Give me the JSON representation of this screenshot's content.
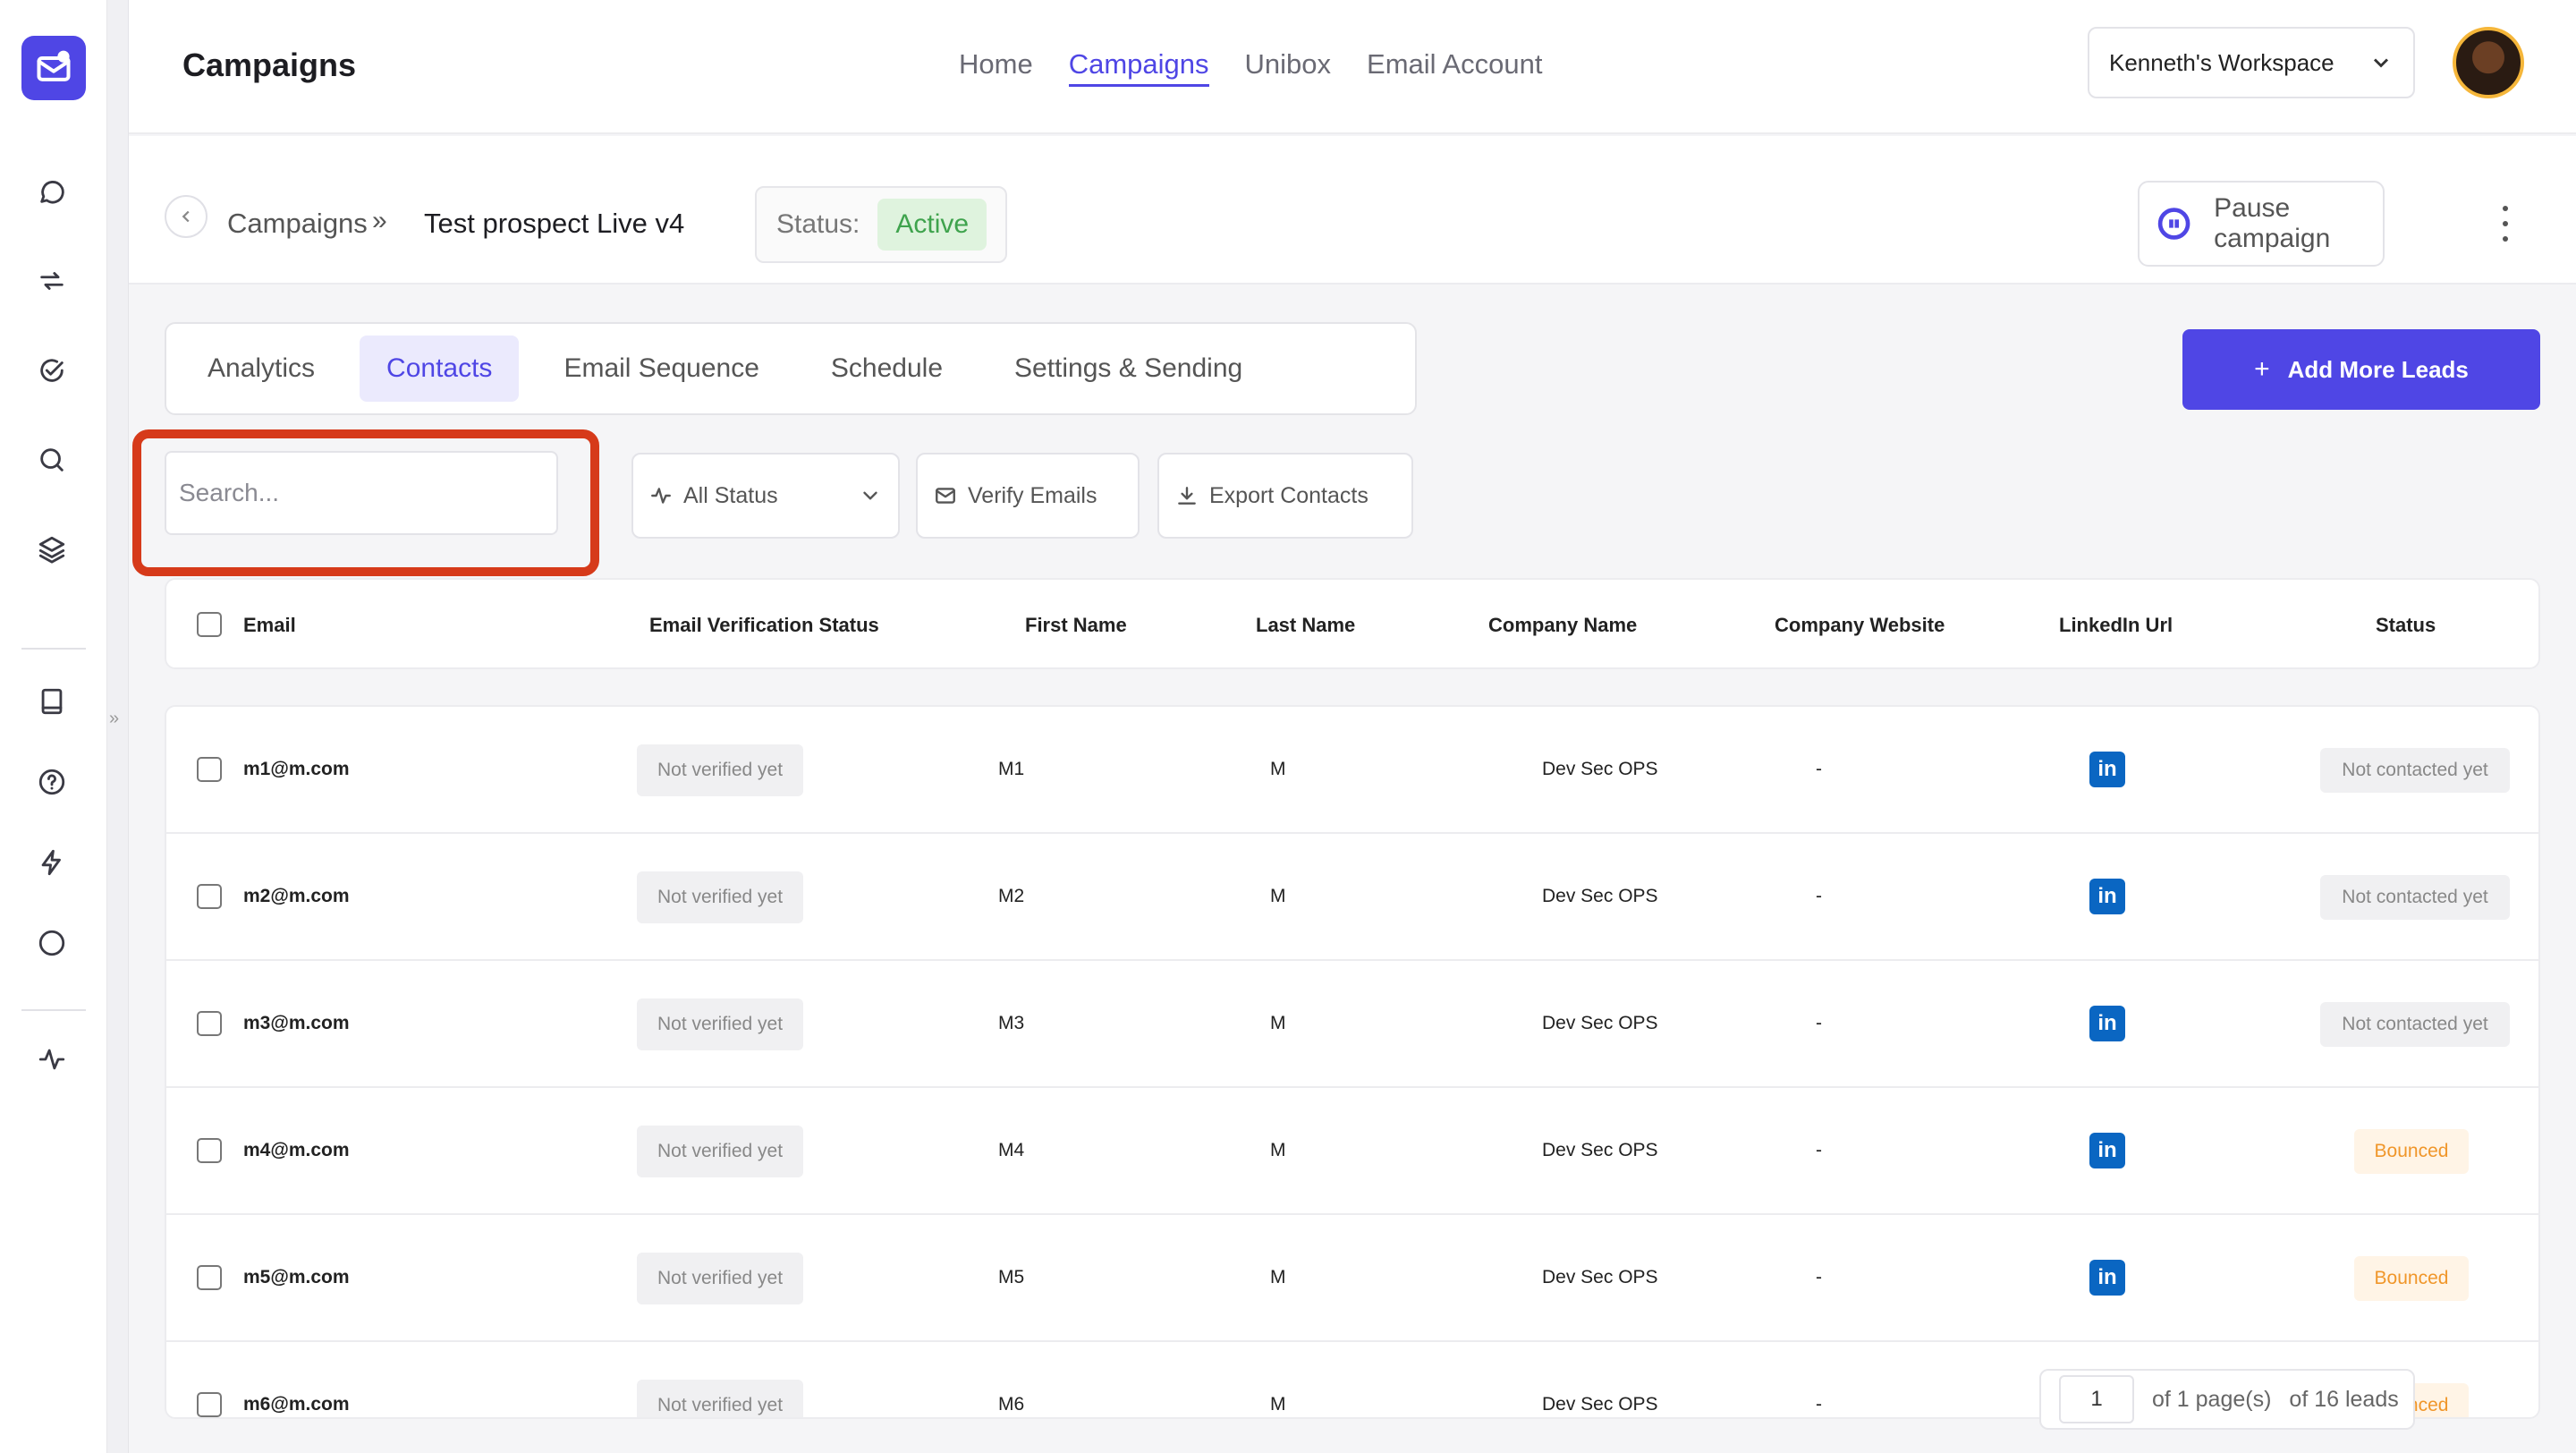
{
  "header": {
    "title": "Campaigns",
    "nav": [
      {
        "label": "Home",
        "active": false
      },
      {
        "label": "Campaigns",
        "active": true
      },
      {
        "label": "Unibox",
        "active": false
      },
      {
        "label": "Email Account",
        "active": false
      }
    ],
    "workspace": "Kenneth's Workspace"
  },
  "breadcrumb": {
    "parent": "Campaigns",
    "separator": "»",
    "current": "Test prospect Live v4"
  },
  "status": {
    "label": "Status:",
    "value": "Active"
  },
  "actions": {
    "pause": "Pause campaign",
    "add_leads": "Add More Leads",
    "add_leads_icon": "+"
  },
  "tabs": [
    {
      "label": "Analytics",
      "active": false
    },
    {
      "label": "Contacts",
      "active": true
    },
    {
      "label": "Email Sequence",
      "active": false
    },
    {
      "label": "Schedule",
      "active": false
    },
    {
      "label": "Settings & Sending",
      "active": false
    }
  ],
  "toolbar": {
    "search_placeholder": "Search...",
    "status_filter": "All Status",
    "verify": "Verify Emails",
    "export": "Export Contacts"
  },
  "table": {
    "columns": [
      "Email",
      "Email Verification Status",
      "First Name",
      "Last Name",
      "Company Name",
      "Company Website",
      "LinkedIn Url",
      "Status"
    ],
    "rows": [
      {
        "email": "m1@m.com",
        "verification": "Not verified yet",
        "first": "M1",
        "last": "M",
        "company": "Dev Sec OPS",
        "website": "-",
        "status": "Not contacted yet"
      },
      {
        "email": "m2@m.com",
        "verification": "Not verified yet",
        "first": "M2",
        "last": "M",
        "company": "Dev Sec OPS",
        "website": "-",
        "status": "Not contacted yet"
      },
      {
        "email": "m3@m.com",
        "verification": "Not verified yet",
        "first": "M3",
        "last": "M",
        "company": "Dev Sec OPS",
        "website": "-",
        "status": "Not contacted yet"
      },
      {
        "email": "m4@m.com",
        "verification": "Not verified yet",
        "first": "M4",
        "last": "M",
        "company": "Dev Sec OPS",
        "website": "-",
        "status": "Bounced"
      },
      {
        "email": "m5@m.com",
        "verification": "Not verified yet",
        "first": "M5",
        "last": "M",
        "company": "Dev Sec OPS",
        "website": "-",
        "status": "Bounced"
      },
      {
        "email": "m6@m.com",
        "verification": "Not verified yet",
        "first": "M6",
        "last": "M",
        "company": "Dev Sec OPS",
        "website": "-",
        "status": "Bounced"
      }
    ],
    "linkedin_glyph": "in"
  },
  "pagination": {
    "page": "1",
    "pages_text": "of 1 page(s)",
    "leads_text": "of 16 leads"
  },
  "colors": {
    "accent": "#4f46e5",
    "active_status": "#3fa34d",
    "bounced": "#f0962a",
    "highlight": "#d63a1a",
    "linkedin": "#0a66c2"
  }
}
